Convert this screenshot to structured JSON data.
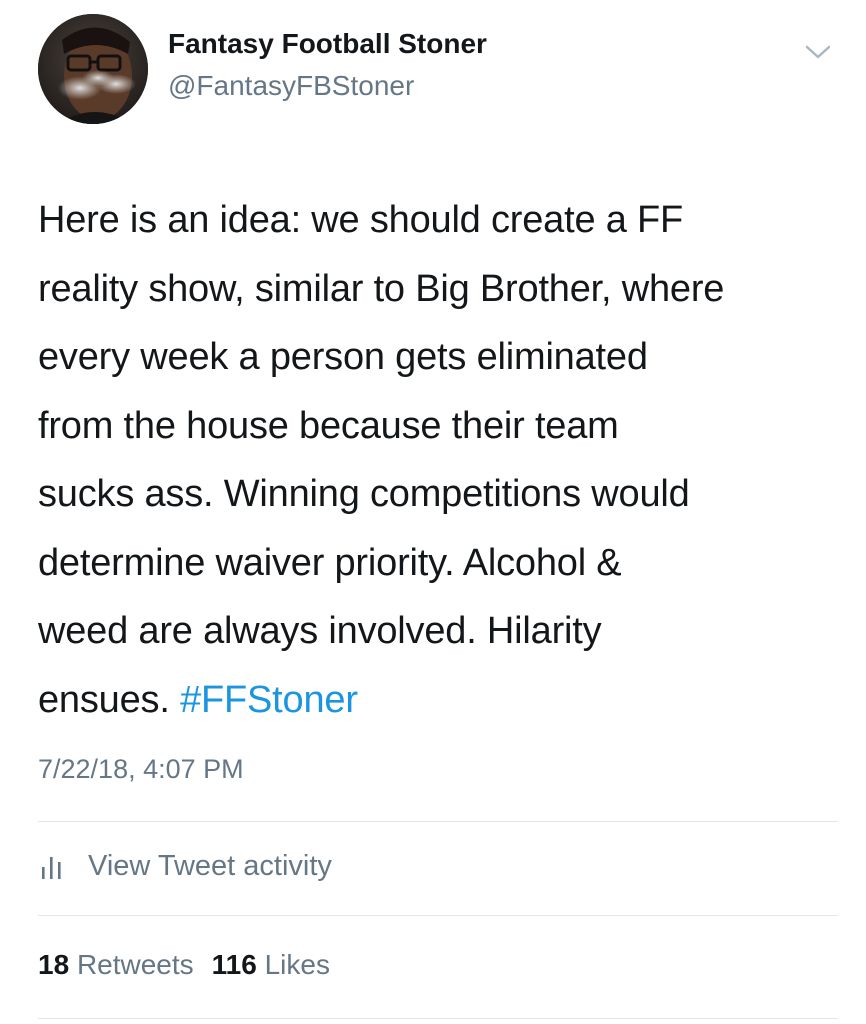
{
  "author": {
    "display_name": "Fantasy Football Stoner",
    "handle": "@FantasyFBStoner",
    "avatar_icon": "profile-photo"
  },
  "tweet": {
    "lines": [
      "Here is an idea: we should create a FF",
      "reality show, similar to Big Brother, where",
      "every week a person gets eliminated",
      "from the house because their team",
      "sucks ass. Winning competitions would",
      "determine waiver priority. Alcohol &",
      "weed are always involved. Hilarity"
    ],
    "last_line_text": "ensues. ",
    "hashtag": "#FFStoner",
    "timestamp": "7/22/18, 4:07 PM"
  },
  "activity": {
    "label": "View Tweet activity",
    "icon": "bar-chart-icon"
  },
  "stats": {
    "retweets_count": "18",
    "retweets_label": "Retweets",
    "likes_count": "116",
    "likes_label": "Likes"
  },
  "colors": {
    "text": "#14171a",
    "secondary": "#657786",
    "link": "#1b95e0",
    "divider": "#e1e8ed"
  }
}
